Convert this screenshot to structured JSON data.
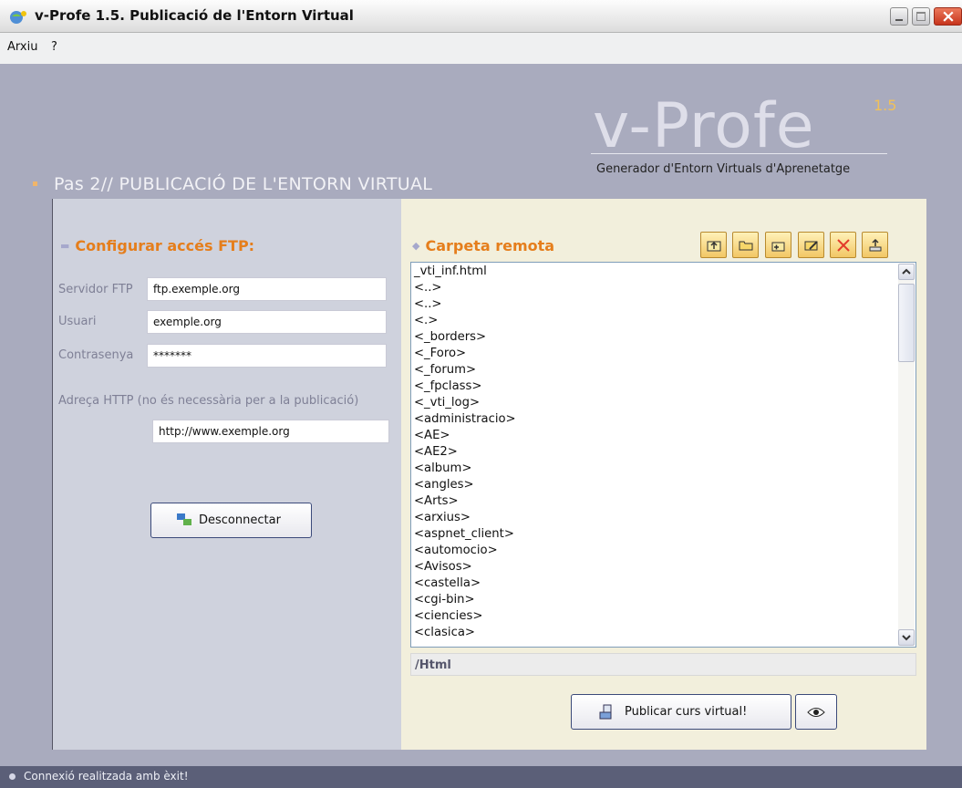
{
  "window": {
    "title": "v-Profe 1.5. Publicació de l'Entorn Virtual",
    "app_icon": "v-profe-globe-icon",
    "controls": [
      "minimize-icon",
      "maximize-icon",
      "close-icon"
    ]
  },
  "menubar": {
    "items": [
      "Arxiu",
      "?"
    ]
  },
  "logo": {
    "name": "v-Profe",
    "version": "1.5",
    "subtitle": "Generador d'Entorn Virtuals d'Aprenetatge"
  },
  "step": {
    "title": "Pas 2//  PUBLICACIÓ DE L'ENTORN VIRTUAL"
  },
  "ftp": {
    "section_title": "Configurar accés FTP:",
    "server_label": "Servidor FTP",
    "server_value": "ftp.exemple.org",
    "user_label": "Usuari",
    "user_value": "exemple.org",
    "password_label": "Contrasenya",
    "password_value": "*******",
    "http_label": "Adreça HTTP (no és necessària per a la publicació)",
    "http_value": "http://www.exemple.org",
    "disconnect_label": "Desconnectar"
  },
  "remote": {
    "section_title": "Carpeta remota",
    "toolbar_icons": [
      "parent-folder-icon",
      "open-folder-icon",
      "new-folder-icon",
      "rename-folder-icon",
      "delete-icon",
      "upload-icon"
    ],
    "files": [
      "_vti_inf.html",
      "<..>",
      "<..>",
      "<.>",
      "<_borders>",
      "<_Foro>",
      "<_forum>",
      "<_fpclass>",
      "<_vti_log>",
      "<administracio>",
      "<AE>",
      "<AE2>",
      "<album>",
      "<angles>",
      "<Arts>",
      "<arxius>",
      "<aspnet_client>",
      "<automocio>",
      "<Avisos>",
      "<castella>",
      "<cgi-bin>",
      "<ciencies>",
      "<clasica>"
    ],
    "current_path": "/Html",
    "publish_label": "Publicar curs virtual!",
    "preview_icon": "eye-icon"
  },
  "status": {
    "text": "Connexió realitzada amb èxit!"
  },
  "colors": {
    "background": "#a9abbe",
    "accent_orange": "#e57e1c",
    "left_panel": "#cfd2dd",
    "right_panel": "#f2efdc",
    "status_bar": "#5b5f78"
  }
}
